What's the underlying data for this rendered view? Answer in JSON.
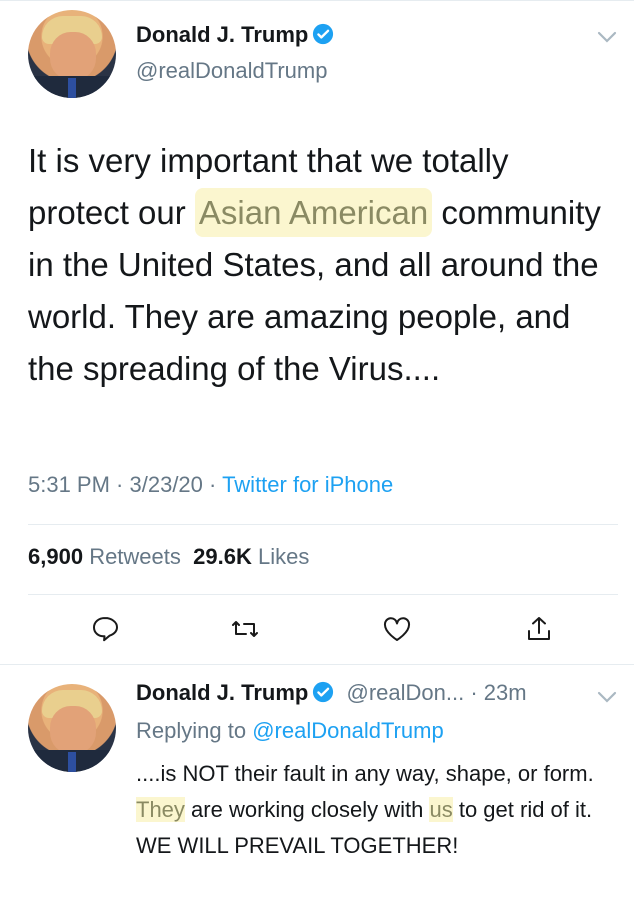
{
  "colors": {
    "accent": "#1da1f2",
    "muted": "#657786",
    "text": "#14171a",
    "highlight": "#fbf6cf"
  },
  "tweet": {
    "name": "Donald J. Trump",
    "handle": "@realDonaldTrump",
    "text_parts": {
      "before": "It is very important that we totally protect our ",
      "highlight": "Asian American",
      "after": " community in the United States, and all around the world. They are amazing people, and the spreading of the Virus...."
    },
    "time": "5:31 PM",
    "date": "3/23/20",
    "source": "Twitter for iPhone",
    "retweets_count": "6,900",
    "retweets_label": "Retweets",
    "likes_count": "29.6K",
    "likes_label": "Likes",
    "icons": [
      "reply-icon",
      "retweet-icon",
      "like-icon",
      "share-icon"
    ]
  },
  "reply": {
    "name": "Donald J. Trump",
    "handle": "@realDon...",
    "age": "23m",
    "replying_label": "Replying to",
    "replying_to": "@realDonaldTrump",
    "text_parts": {
      "p1": "....is NOT their fault in any way, shape, or form. ",
      "they": "They",
      "p2": " are working closely with ",
      "us": "us",
      "p3": " to get rid of it. WE WILL PREVAIL TOGETHER!"
    }
  }
}
